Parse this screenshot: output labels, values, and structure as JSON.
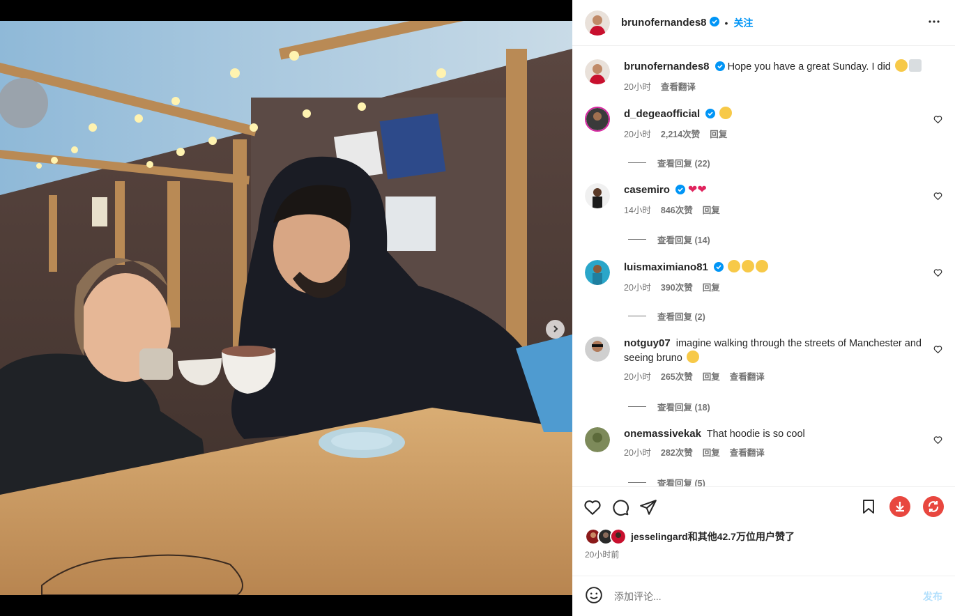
{
  "post": {
    "author": "brunofernandes8",
    "follow_label": "关注",
    "separator": "•",
    "caption": "Hope you have a great Sunday. I did",
    "caption_time": "20小时",
    "caption_translate": "查看翻译"
  },
  "comments": [
    {
      "user": "d_degeaofficial",
      "text": "",
      "time": "20小时",
      "likes": "2,214次赞",
      "reply": "回复",
      "view_replies": "查看回复 (22)"
    },
    {
      "user": "casemiro",
      "text": "",
      "time": "14小时",
      "likes": "846次赞",
      "reply": "回复",
      "view_replies": "查看回复 (14)"
    },
    {
      "user": "luismaximiano81",
      "text": "",
      "time": "20小时",
      "likes": "390次赞",
      "reply": "回复",
      "view_replies": "查看回复 (2)"
    },
    {
      "user": "notguy07",
      "text": "imagine walking through the streets of Manchester and seeing bruno",
      "time": "20小时",
      "likes": "265次赞",
      "reply": "回复",
      "translate": "查看翻译",
      "view_replies": "查看回复 (18)"
    },
    {
      "user": "onemassivekak",
      "text": "That hoodie is so cool",
      "time": "20小时",
      "likes": "282次赞",
      "reply": "回复",
      "translate": "查看翻译",
      "view_replies": "查看回复 (5)"
    }
  ],
  "likes_summary": {
    "user": "jesselingard",
    "rest": "和其他42.7万位用户赞了"
  },
  "posted_ago": "20小时前",
  "comment_box": {
    "placeholder": "添加评论...",
    "post_label": "发布"
  },
  "colors": {
    "accent": "#0095f6",
    "verified": "#0095f6",
    "heart_red": "#ed4956",
    "download_red": "#e8473f"
  },
  "icons": [
    "heart-icon",
    "comment-icon",
    "share-icon",
    "bookmark-icon",
    "download-icon",
    "refresh-icon",
    "emoji-icon",
    "more-icon",
    "chevron-right-icon"
  ]
}
